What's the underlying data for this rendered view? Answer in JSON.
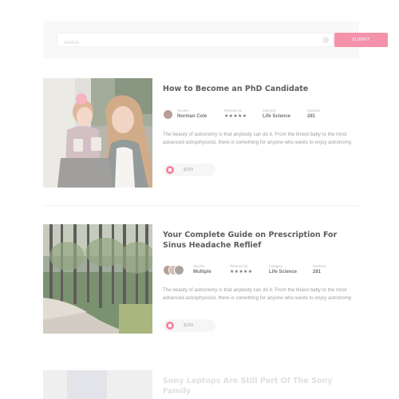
{
  "search": {
    "placeholder": "Search",
    "submit_label": "SUBMIT"
  },
  "courses": [
    {
      "title": "How to Become an PhD Candidate",
      "meta": [
        {
          "label": "Teacher",
          "value": "Norman Cole"
        },
        {
          "label": "Reviews (3)",
          "value": "★★★★★"
        },
        {
          "label": "Category",
          "value": "Life Science"
        },
        {
          "label": "Students",
          "value": "281"
        }
      ],
      "description": "The beauty of astronomy is that anybody can do it. From the tiniest baby to the most advanced astrophysicist, there is something for anyone who wants to enjoy astronomy.",
      "price": "$299"
    },
    {
      "title": "Your Complete Guide on Prescription For Sinus Headache Reflief",
      "meta": [
        {
          "label": "Teacher",
          "value": "Multiple"
        },
        {
          "label": "Reviews (3)",
          "value": "★★★★★"
        },
        {
          "label": "Category",
          "value": "Life Science"
        },
        {
          "label": "Students",
          "value": "281"
        }
      ],
      "description": "The beauty of astronomy is that anybody can do it. From the tiniest baby to the most advanced astrophysicist, there is something for anyone who wants to enjoy astronomy.",
      "price": "$299"
    },
    {
      "title": "Sony Laptops Are Still Part Of The Sony Family"
    }
  ],
  "colors": {
    "accent": "#f27a98",
    "cart": "#ee6a8c",
    "panel": "#f7f7f7"
  }
}
